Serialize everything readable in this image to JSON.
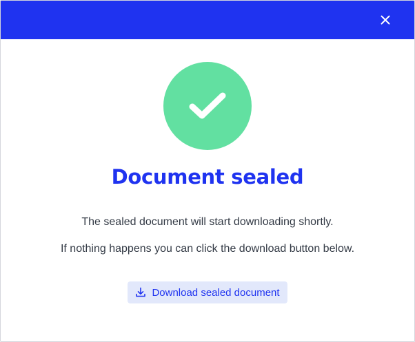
{
  "dialog": {
    "title": "Document sealed",
    "message_line1": "The sealed document will start downloading shortly.",
    "message_line2": "If nothing happens you can click the download button below.",
    "download_label": "Download sealed document",
    "close_icon": "close-icon",
    "success_icon": "checkmark-icon",
    "download_icon": "download-icon"
  },
  "colors": {
    "header_bg": "#1f33f0",
    "title": "#1f33f0",
    "success": "#62e0a1",
    "button_bg": "#e2e8fb",
    "button_text": "#1f33f0"
  }
}
